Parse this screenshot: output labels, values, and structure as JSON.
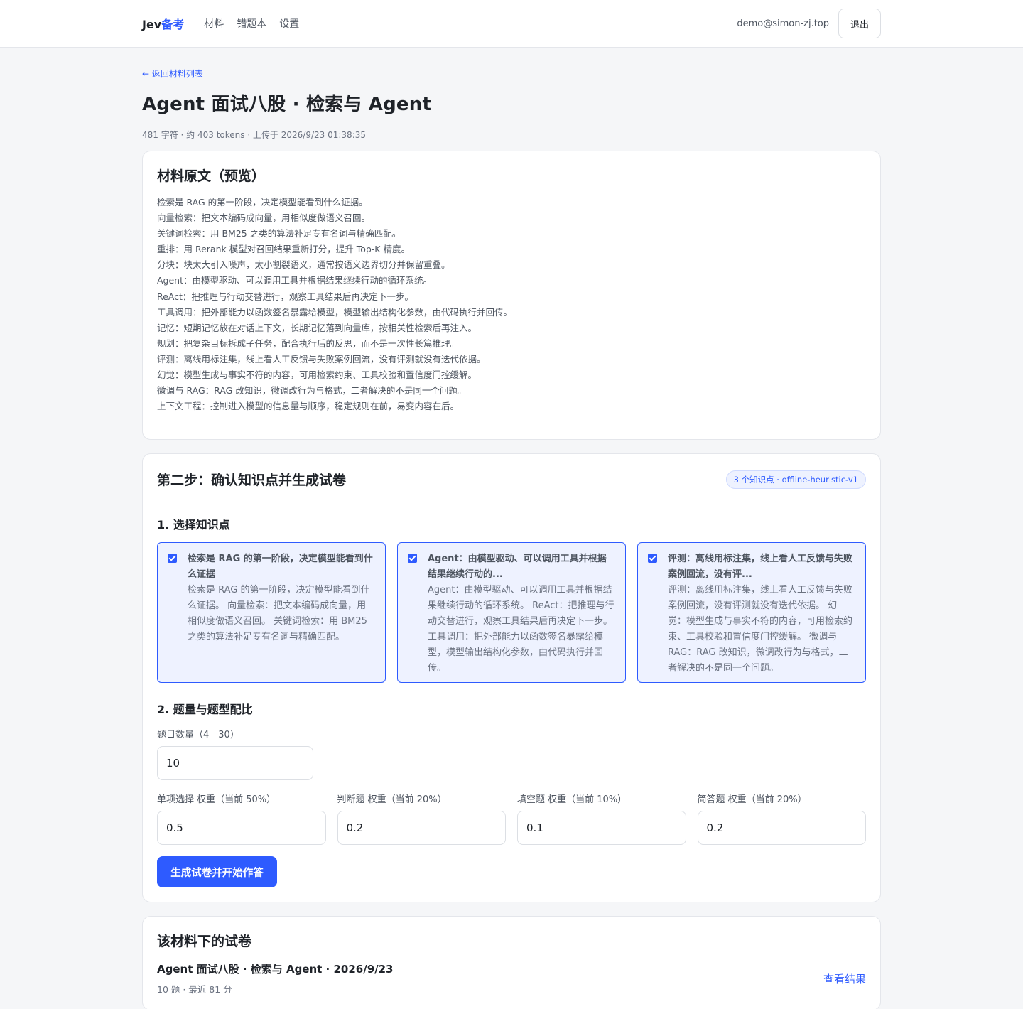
{
  "header": {
    "brand_part1": "Jev",
    "brand_part2": "备考",
    "nav": [
      "材料",
      "错题本",
      "设置"
    ],
    "user_email": "demo@simon-zj.top",
    "logout_label": "退出"
  },
  "page": {
    "back_label": "← 返回材料列表",
    "title": "Agent 面试八股 · 检索与 Agent",
    "meta": "481 字符 · 约 403 tokens · 上传于 2026/9/23 01:38:35"
  },
  "preview": {
    "title": "材料原文（预览）",
    "lines": [
      "检索是 RAG 的第一阶段，决定模型能看到什么证据。",
      "向量检索：把文本编码成向量，用相似度做语义召回。",
      "关键词检索：用 BM25 之类的算法补足专有名词与精确匹配。",
      "重排：用 Rerank 模型对召回结果重新打分，提升 Top-K 精度。",
      "分块：块太大引入噪声，太小割裂语义，通常按语义边界切分并保留重叠。",
      "Agent：由模型驱动、可以调用工具并根据结果继续行动的循环系统。",
      "ReAct：把推理与行动交替进行，观察工具结果后再决定下一步。",
      "工具调用：把外部能力以函数签名暴露给模型，模型输出结构化参数，由代码执行并回传。",
      "记忆：短期记忆放在对话上下文，长期记忆落到向量库，按相关性检索后再注入。",
      "规划：把复杂目标拆成子任务，配合执行后的反思，而不是一次性长篇推理。",
      "评测：离线用标注集，线上看人工反馈与失败案例回流，没有评测就没有迭代依据。",
      "幻觉：模型生成与事实不符的内容，可用检索约束、工具校验和置信度门控缓解。",
      "微调与 RAG：RAG 改知识，微调改行为与格式，二者解决的不是同一个问题。",
      "上下文工程：控制进入模型的信息量与顺序，稳定规则在前，易变内容在后。"
    ]
  },
  "step2": {
    "title": "第二步：确认知识点并生成试卷",
    "badge": "3 个知识点 · offline-heuristic-v1",
    "section1_title": "1. 选择知识点",
    "knowledge_points": [
      {
        "checked": true,
        "title": "检索是 RAG 的第一阶段，决定模型能看到什么证据",
        "desc": "检索是 RAG 的第一阶段，决定模型能看到什么证据。 向量检索：把文本编码成向量，用相似度做语义召回。 关键词检索：用 BM25 之类的算法补足专有名词与精确匹配。"
      },
      {
        "checked": true,
        "title": "Agent：由模型驱动、可以调用工具并根据结果继续行动的...",
        "desc": "Agent：由模型驱动、可以调用工具并根据结果继续行动的循环系统。 ReAct：把推理与行动交替进行，观察工具结果后再决定下一步。 工具调用：把外部能力以函数签名暴露给模型，模型输出结构化参数，由代码执行并回传。"
      },
      {
        "checked": true,
        "title": "评测：离线用标注集，线上看人工反馈与失败案例回流，没有评...",
        "desc": "评测：离线用标注集，线上看人工反馈与失败案例回流，没有评测就没有迭代依据。 幻觉：模型生成与事实不符的内容，可用检索约束、工具校验和置信度门控缓解。 微调与 RAG：RAG 改知识，微调改行为与格式，二者解决的不是同一个问题。"
      }
    ],
    "section2_title": "2. 题量与题型配比",
    "count_label": "题目数量（4—30）",
    "count_value": "10",
    "weights": [
      {
        "label": "单项选择 权重（当前 50%）",
        "value": "0.5"
      },
      {
        "label": "判断题 权重（当前 20%）",
        "value": "0.2"
      },
      {
        "label": "填空题 权重（当前 10%）",
        "value": "0.1"
      },
      {
        "label": "简答题 权重（当前 20%）",
        "value": "0.2"
      }
    ],
    "generate_label": "生成试卷并开始作答"
  },
  "papers": {
    "title": "该材料下的试卷",
    "items": [
      {
        "title": "Agent 面试八股 · 检索与 Agent · 2026/9/23",
        "meta": "10 题 · 最近 81 分",
        "action": "查看结果"
      }
    ]
  },
  "colors": {
    "accent": "#2e5bff",
    "background": "#f5f6f8",
    "card": "#ffffff",
    "kp_selected_bg": "#eef2ff"
  }
}
